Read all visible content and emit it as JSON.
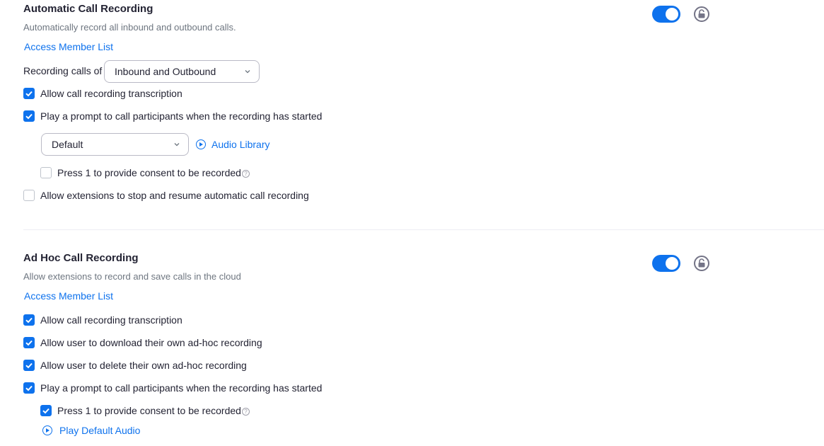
{
  "colors": {
    "accent": "#0e72ed",
    "text": "#232333",
    "muted": "#6e7680"
  },
  "automatic": {
    "title": "Automatic Call Recording",
    "description": "Automatically record all inbound and outbound calls.",
    "access_link": "Access Member List",
    "toggle_on": true,
    "lock_icon": "unlock-icon",
    "recording_calls_label": "Recording calls of",
    "recording_calls_value": "Inbound and Outbound",
    "allow_transcription": {
      "label": "Allow call recording transcription",
      "checked": true
    },
    "play_prompt": {
      "label": "Play a prompt to call participants when the recording has started",
      "checked": true
    },
    "prompt_audio_value": "Default",
    "audio_library_link": "Audio Library",
    "press1_consent": {
      "label": "Press 1 to provide consent to be recorded",
      "checked": false,
      "help": "?"
    },
    "allow_stop_resume": {
      "label": "Allow extensions to stop and resume automatic call recording",
      "checked": false
    }
  },
  "adhoc": {
    "title": "Ad Hoc Call Recording",
    "description": "Allow extensions to record and save calls in the cloud",
    "access_link": "Access Member List",
    "toggle_on": true,
    "lock_icon": "unlock-icon",
    "allow_transcription": {
      "label": "Allow call recording transcription",
      "checked": true
    },
    "allow_download": {
      "label": "Allow user to download their own ad-hoc recording",
      "checked": true
    },
    "allow_delete": {
      "label": "Allow user to delete their own ad-hoc recording",
      "checked": true
    },
    "play_prompt": {
      "label": "Play a prompt to call participants when the recording has started",
      "checked": true
    },
    "press1_consent": {
      "label": "Press 1 to provide consent to be recorded",
      "checked": true,
      "help": "?"
    },
    "play_default_audio_link": "Play Default Audio"
  }
}
